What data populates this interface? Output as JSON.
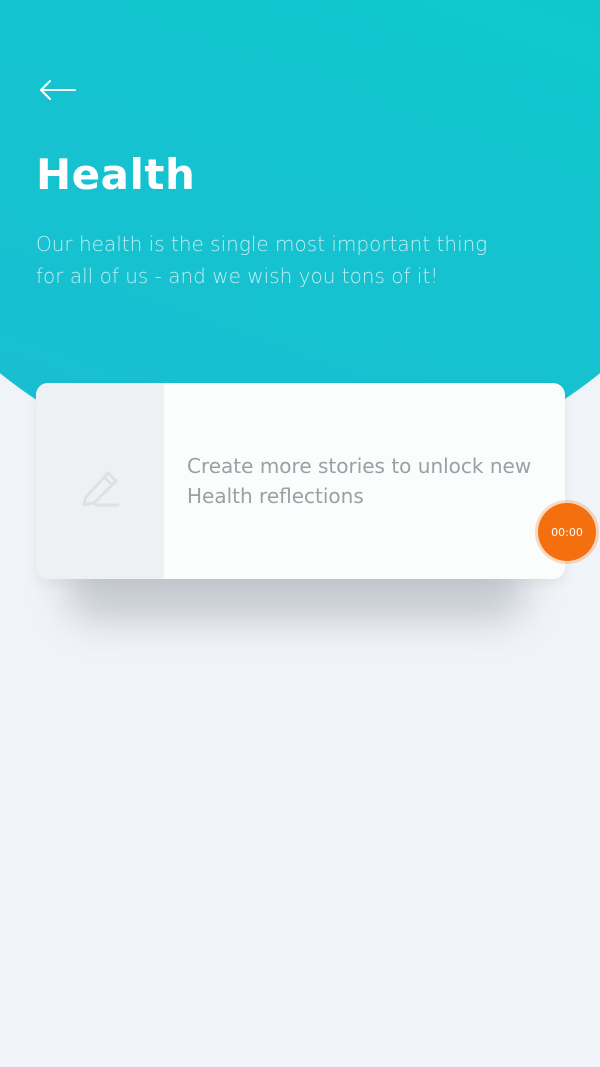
{
  "header": {
    "back_icon": "arrow-left-icon",
    "title": "Health",
    "description": "Our health is the single most important thing for all of us - and we wish you tons of it!"
  },
  "card": {
    "icon": "pencil-icon",
    "message": "Create more stories to unlock new Health reflections"
  },
  "timer": {
    "value": "00:00"
  },
  "colors": {
    "hero_gradient_start": "#05d3c9",
    "hero_gradient_end": "#19bdd2",
    "background": "#f0f3f7",
    "timer_accent": "#f46f0e",
    "message_text": "#9aa0a6"
  }
}
